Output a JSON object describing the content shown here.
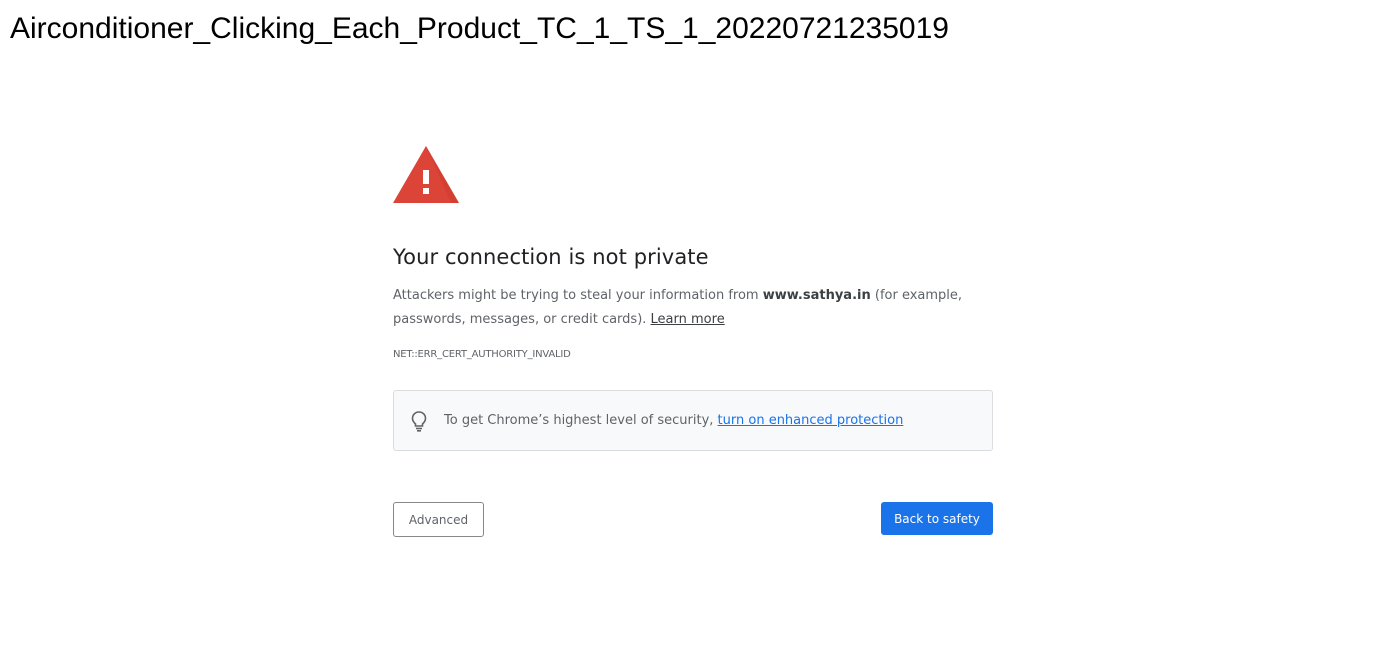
{
  "caption": "Airconditioner_Clicking_Each_Product_TC_1_TS_1_20220721235019",
  "interstitial": {
    "warning_icon": "warning-triangle-icon",
    "warning_color": "#db4437",
    "heading": "Your connection is not private",
    "explanation_prefix": "Attackers might be trying to steal your information from ",
    "domain": "www.sathya.in",
    "explanation_suffix": " (for example, passwords, messages, or credit cards). ",
    "learn_more": "Learn more",
    "error_code": "NET::ERR_CERT_AUTHORITY_INVALID",
    "enhanced_protection": {
      "icon": "lightbulb-icon",
      "text": "To get Chrome’s highest level of security, ",
      "link": "turn on enhanced protection"
    },
    "advanced_button": "Advanced",
    "back_button": "Back to safety",
    "accent_color": "#1a73e8"
  }
}
